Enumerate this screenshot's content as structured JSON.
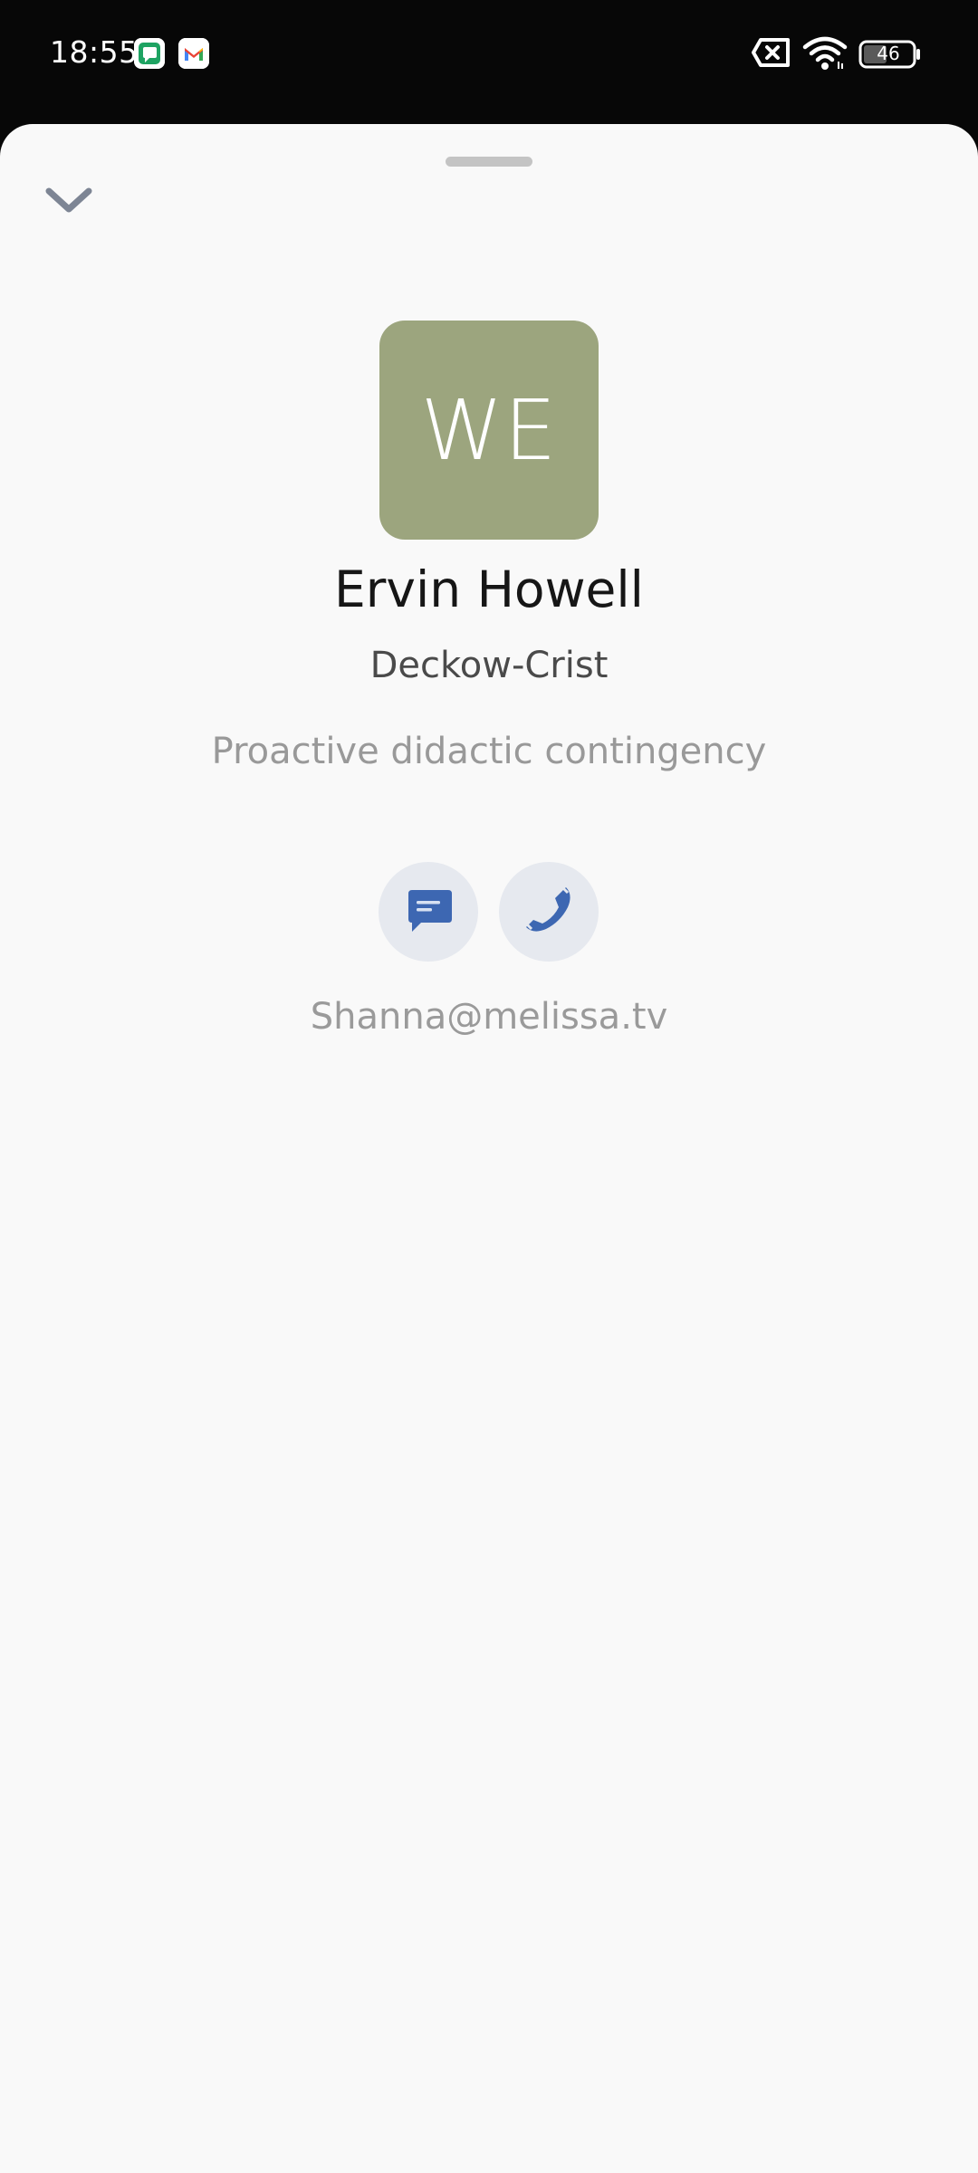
{
  "status_bar": {
    "time": "18:55",
    "battery_level": "46",
    "notification_icons": [
      "messages-app-icon",
      "gmail-icon"
    ],
    "system_icons": [
      "no-sim-icon",
      "wifi-icon",
      "battery-icon"
    ]
  },
  "sheet": {
    "collapse_icon": "chevron-down-icon"
  },
  "contact": {
    "initials": "WE",
    "avatar_color": "#9ca57e",
    "name": "Ervin Howell",
    "company": "Deckow-Crist",
    "catch_phrase": "Proactive didactic contingency",
    "email": "Shanna@melissa.tv"
  },
  "actions": {
    "accent_color": "#3d67b2",
    "items": [
      {
        "icon": "message-icon"
      },
      {
        "icon": "phone-icon"
      }
    ]
  }
}
